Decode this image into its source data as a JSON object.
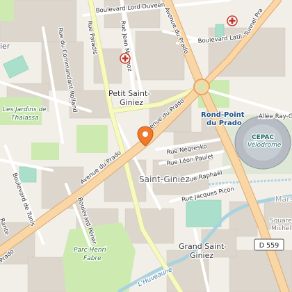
{
  "map": {
    "place_labels": {
      "petit_saint_giniez_line1": "Petit Saint-",
      "petit_saint_giniez_line2": "Giniez",
      "saint_giniez": "Saint-Giniez",
      "grand_saint_giniez_line1": "Grand Saint-",
      "grand_saint_giniez_line2": "Giniez",
      "rond_point_line1": "Rond-Point",
      "rond_point_line2": "du Prado",
      "cepac_line1": "CEPAC",
      "cepac_line2": "Vélodrome",
      "marseille_fragment": "Mars",
      "square_line1": "Square",
      "square_line2": "Michel",
      "ier_fragment": "ier"
    },
    "park_labels": {
      "jardins_line1": "Les Jardins de",
      "jardins_line2": "Thalassa",
      "parc_line1": "Parc Henri",
      "parc_line2": "Fabre",
      "huveaune": "L'Huveaune"
    },
    "street_labels": {
      "bd_lord_duveen": "Boulevard Lord Duveen",
      "rue_paradis": "Rue Paradis",
      "rue_jean_mermoz": "Rue Jean Mermoz",
      "rue_commandant_rolland": "Rue du Commandant Rolland",
      "avenue_du_prado_upper": "Avenue du Prado",
      "avenue_du_prado_lower": "Avenue du Prado",
      "rue_negresko": "Rue Négresko",
      "rue_leon_paulet": "Rue Léon Paulet",
      "rue_raphael": "Rue Raphaël",
      "rue_jacques_picon": "Rue Jacques Picon",
      "bd_de_tunis": "Boulevard de Tunis",
      "bd_perier": "Boulevard Périer",
      "bd_latil": "Boulevard Latil",
      "tunnel_prado": "Tunnel Pra",
      "allee_ray_grassi": "Allée Ray-Gra",
      "rue_rante_fragment": "Rue",
      "rue_rante_fragment2": "Rante",
      "prado_corner": "Prado"
    },
    "road_shield": "D 559",
    "colors": {
      "background": "#f2efe9",
      "primary_road": "#f8d6a5",
      "primary_road_casing": "#e0a76a",
      "trunk_road": "#fcd6a4",
      "secondary_road": "#f7fabf",
      "minor_road": "#ffffff",
      "building": "#ddd6cd",
      "park": "#cdebb0",
      "sports_pitch": "#aae0cb",
      "water": "#aad3df",
      "marker": "#f07a2a",
      "hospital": "#c0392b"
    },
    "icons": [
      "location-pin-icon",
      "hospital-icon",
      "hospital-icon"
    ]
  }
}
